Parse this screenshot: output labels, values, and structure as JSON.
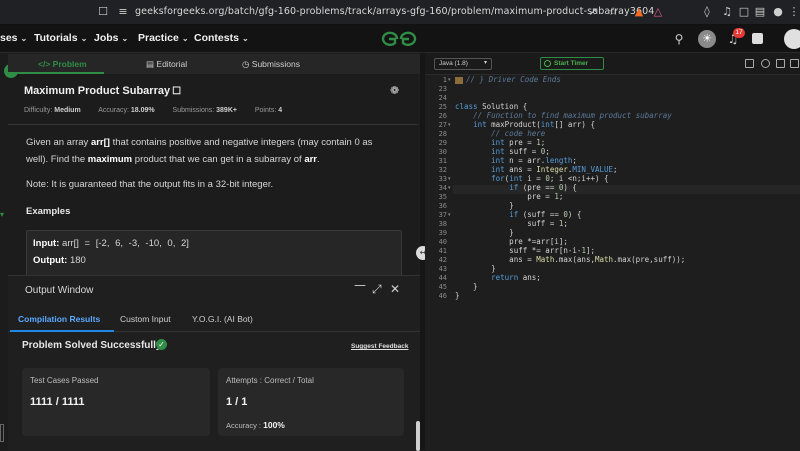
{
  "browser": {
    "url": "geeksforgeeks.org/batch/gfg-160-problems/track/arrays-gfg-160/problem/maximum-product-subarray3604"
  },
  "nav": {
    "items": [
      {
        "label": "ses"
      },
      {
        "label": "Tutorials"
      },
      {
        "label": "Jobs"
      },
      {
        "label": "Practice"
      },
      {
        "label": "Contests"
      }
    ],
    "logo": "GG",
    "notif_count": "17"
  },
  "problem_tabs": [
    "Problem",
    "Editorial",
    "Submissions"
  ],
  "problem": {
    "title": "Maximum Product Subarray",
    "difficulty_label": "Difficulty:",
    "difficulty": "Medium",
    "accuracy_label": "Accuracy:",
    "accuracy": "18.09%",
    "submissions_label": "Submissions:",
    "submissions": "389K+",
    "points_label": "Points:",
    "points": "4",
    "desc_1": "Given an array",
    "desc_arr": "arr[]",
    "desc_2": "that contains positive and negative integers (may contain 0 as well). Find the",
    "desc_max": "maximum",
    "desc_3": "product that we can get in a subarray of",
    "desc_arr2": "arr",
    "desc_4": ".",
    "note": "Note: It is guaranteed that the output fits in a 32-bit integer.",
    "examples_heading": "Examples",
    "example_input_label": "Input:",
    "example_input": "arr[] = [-2, 6, -3, -10, 0, 2]",
    "example_output_label": "Output:",
    "example_output": "180"
  },
  "output_window": {
    "title": "Output Window",
    "tabs": [
      "Compilation Results",
      "Custom Input",
      "Y.O.G.I. (AI Bot)"
    ],
    "status": "Problem Solved Successfully",
    "suggest": "Suggest Feedback",
    "cases_label": "Test Cases Passed",
    "cases_value": "1111 / 1111",
    "attempts_label": "Attempts : Correct / Total",
    "attempts_value": "1 / 1",
    "accuracy_label": "Accuracy :",
    "accuracy_value": "100%"
  },
  "editor": {
    "language": "Java (1.8)",
    "timer": "Start Timer",
    "line_numbers": [
      "1",
      "23",
      "24",
      "25",
      "26",
      "27",
      "28",
      "29",
      "30",
      "31",
      "32",
      "33",
      "34",
      "35",
      "36",
      "37",
      "38",
      "39",
      "40",
      "41",
      "42",
      "43",
      "44",
      "45",
      "46"
    ],
    "code": [
      "// } Driver Code Ends",
      "",
      "",
      "class Solution {",
      "    // Function to find maximum product subarray",
      "    int maxProduct(int[] arr) {",
      "        // code here",
      "        int pre = 1;",
      "        int suff = 0;",
      "        int n = arr.length;",
      "        int ans = Integer.MIN_VALUE;",
      "        for(int i = 0; i <n;i++) {",
      "            if (pre == 0) {",
      "                pre = 1;",
      "            }",
      "            if (suff == 0) {",
      "                suff = 1;",
      "            }",
      "            pre *=arr[i];",
      "            suff *= arr[n-i-1];",
      "            ans = Math.max(ans,Math.max(pre,suff));",
      "        }",
      "        return ans;",
      "    }",
      "}"
    ]
  }
}
